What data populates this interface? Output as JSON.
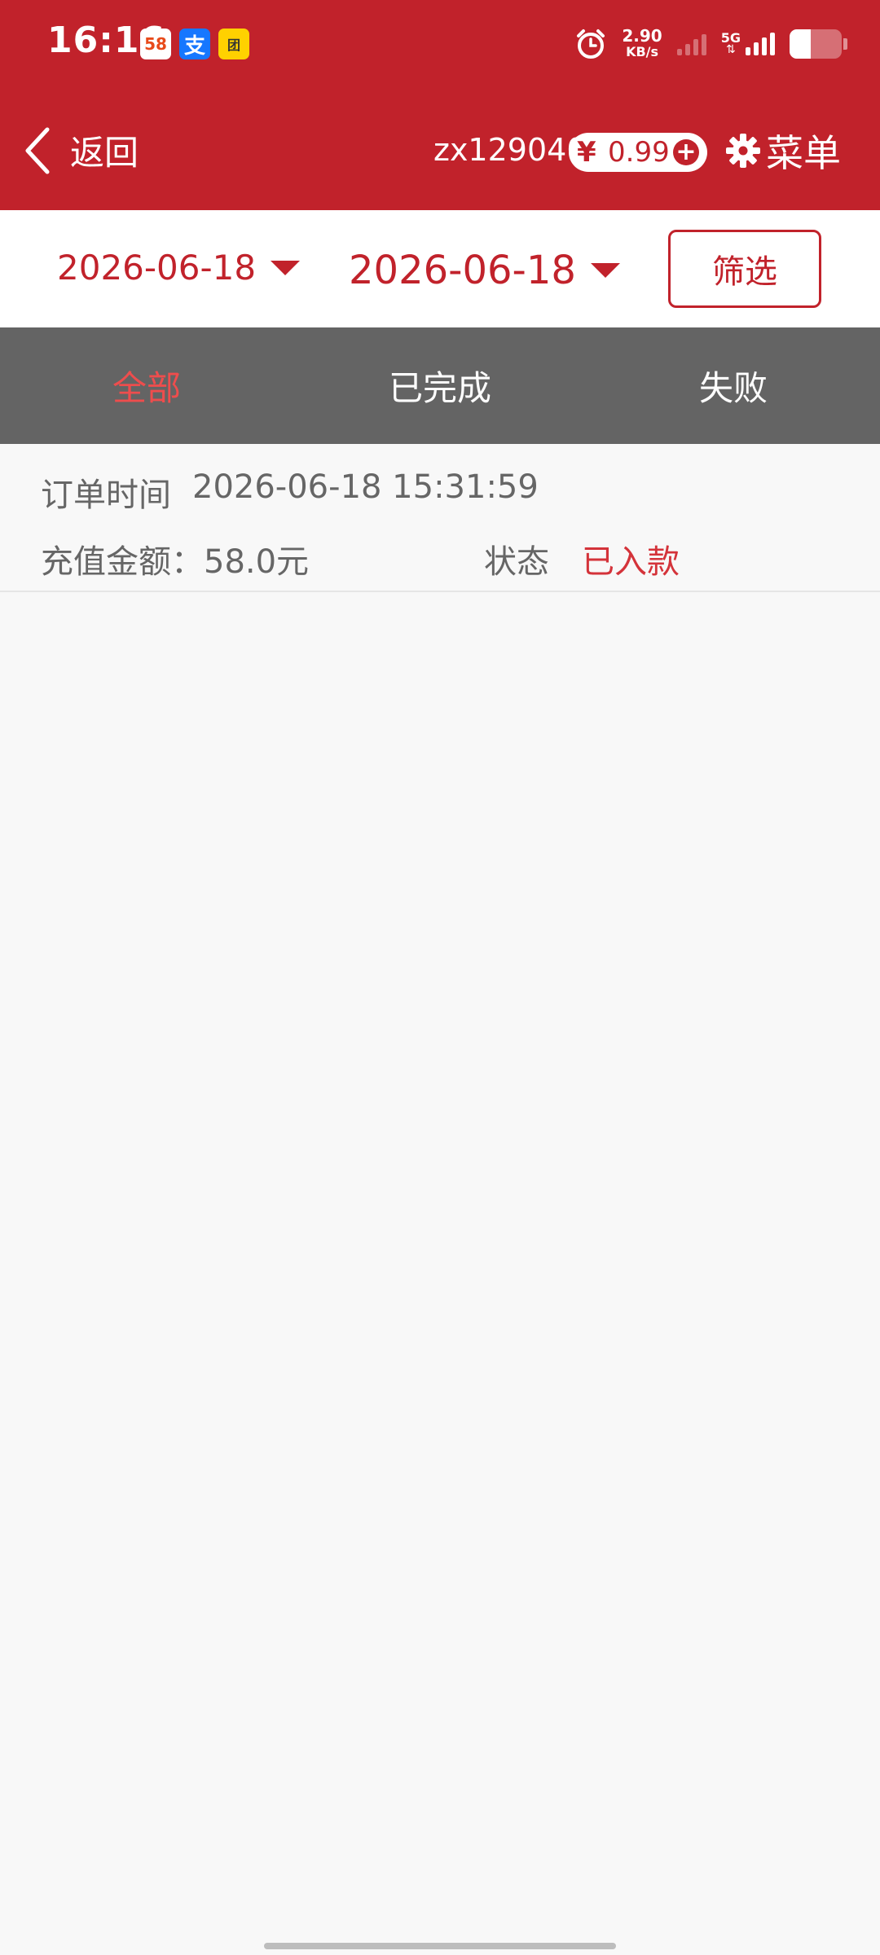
{
  "status_bar": {
    "time": "16:16",
    "notifications": [
      {
        "icon": "app-58-icon",
        "label": "58"
      },
      {
        "icon": "alipay-icon",
        "label": "支"
      },
      {
        "icon": "meituan-icon",
        "label": "团"
      }
    ],
    "net_speed_value": "2.90",
    "net_speed_unit": "KB/s",
    "network_type": "5G",
    "battery_level": 0.4
  },
  "header": {
    "back_label": "返回",
    "username": "zx129040",
    "balance_symbol": "¥",
    "balance": "0.99",
    "add_symbol": "+",
    "menu_label": "菜单"
  },
  "filter": {
    "start_date": "2026-06-18",
    "end_date": "2026-06-18",
    "filter_label": "筛选"
  },
  "tabs": [
    {
      "label": "全部",
      "active": true
    },
    {
      "label": "已完成",
      "active": false
    },
    {
      "label": "失败",
      "active": false
    }
  ],
  "records": [
    {
      "time_label": "订单时间",
      "time_value": "2026-06-18 15:31:59",
      "amount_text": "充值金额：58.0元",
      "status_label": "状态",
      "status_value": "已入款"
    }
  ],
  "colors": {
    "brand_red": "#c1222b",
    "tab_bar": "#646464",
    "active_tab": "#ee4d4d",
    "status_ok": "#d4333a"
  }
}
